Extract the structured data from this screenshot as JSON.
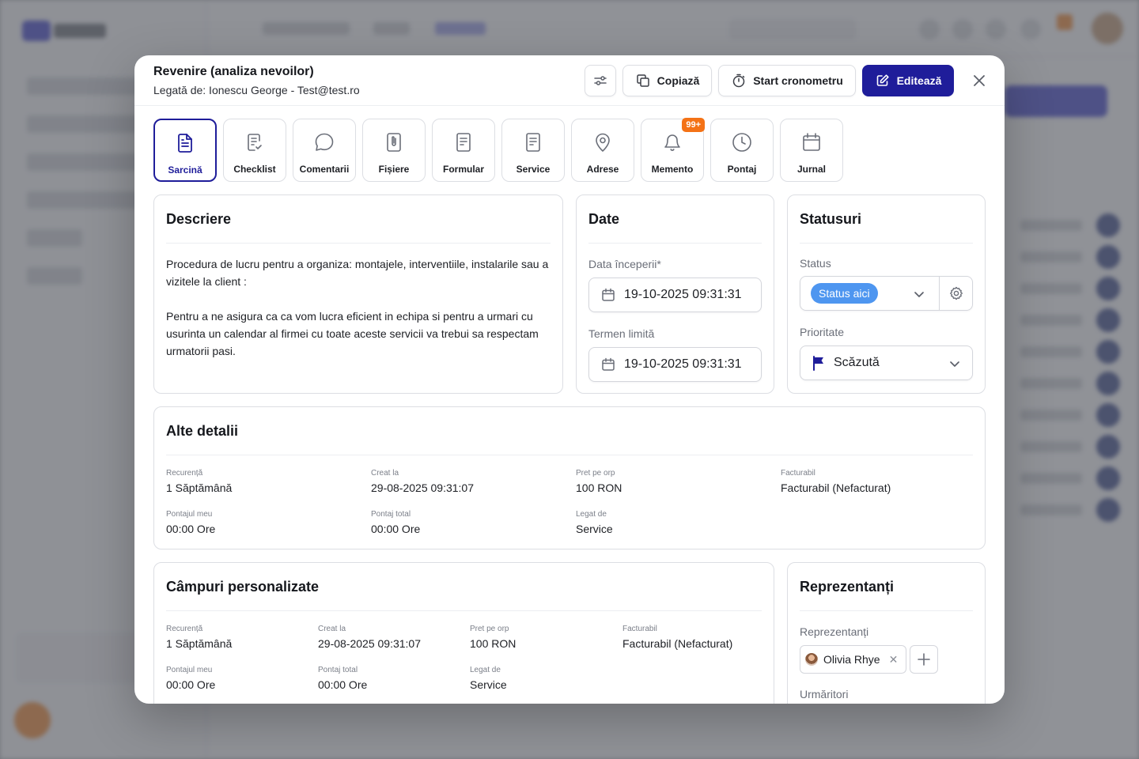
{
  "modal": {
    "title": "Revenire (analiza nevoilor)",
    "subtitle": "Legată de: Ionescu George - Test@test.ro",
    "buttons": {
      "copy": "Copiază",
      "timer": "Start cronometru",
      "edit": "Editează"
    }
  },
  "tabs": [
    {
      "label": "Sarcină",
      "icon": "task-doc-icon",
      "active": true
    },
    {
      "label": "Checklist",
      "icon": "checklist-icon"
    },
    {
      "label": "Comentarii",
      "icon": "comment-bubble-icon"
    },
    {
      "label": "Fișiere",
      "icon": "paperclip-file-icon"
    },
    {
      "label": "Formular",
      "icon": "form-doc-icon"
    },
    {
      "label": "Service",
      "icon": "service-doc-icon"
    },
    {
      "label": "Adrese",
      "icon": "map-pin-icon"
    },
    {
      "label": "Memento",
      "icon": "bell-icon",
      "badge": "99+"
    },
    {
      "label": "Pontaj",
      "icon": "clock-icon"
    },
    {
      "label": "Jurnal",
      "icon": "calendar-icon"
    }
  ],
  "description": {
    "title": "Descriere",
    "paragraph1": "Procedura de lucru pentru a organiza: montajele, interventiile, instalarile sau a vizitele la client :",
    "paragraph2": "Pentru a ne asigura ca ca vom lucra eficient in echipa si pentru a urmari cu usurinta un calendar al firmei cu toate aceste servicii va trebui sa respectam urmatorii pasi."
  },
  "dates": {
    "title": "Date",
    "start_label": "Data începerii",
    "start_required": "*",
    "start_value": "19-10-2025 09:31:31",
    "deadline_label": "Termen limită",
    "deadline_value": "19-10-2025 09:31:31"
  },
  "statuses": {
    "title": "Statusuri",
    "status_label": "Status",
    "status_value": "Status aici",
    "status_color": "#4e96f0",
    "priority_label": "Prioritate",
    "priority_value": "Scăzută",
    "priority_flag_color": "#1f1d9a"
  },
  "other_details": {
    "title": "Alte detalii",
    "fields": [
      {
        "label": "Recurență",
        "value": "1 Săptămână"
      },
      {
        "label": "Creat la",
        "value": "29-08-2025 09:31:07"
      },
      {
        "label": "Pret pe orp",
        "value": "100 RON"
      },
      {
        "label": "Facturabil",
        "value": "Facturabil (Nefacturat)"
      },
      {
        "label": "Pontajul meu",
        "value": "00:00 Ore"
      },
      {
        "label": "Pontaj total",
        "value": "00:00 Ore"
      },
      {
        "label": "Legat de",
        "value": "Service"
      }
    ]
  },
  "custom_fields": {
    "title": "Câmpuri personalizate",
    "fields": [
      {
        "label": "Recurență",
        "value": "1 Săptămână"
      },
      {
        "label": "Creat la",
        "value": "29-08-2025 09:31:07"
      },
      {
        "label": "Pret pe orp",
        "value": "100 RON"
      },
      {
        "label": "Facturabil",
        "value": "Facturabil (Nefacturat)"
      },
      {
        "label": "Pontajul meu",
        "value": "00:00 Ore"
      },
      {
        "label": "Pontaj total",
        "value": "00:00 Ore"
      },
      {
        "label": "Legat de",
        "value": "Service"
      }
    ]
  },
  "representatives": {
    "title": "Reprezentanți",
    "label": "Reprezentanți",
    "person": "Olivia Rhye",
    "followers_label": "Urmăritori"
  },
  "colors": {
    "primary": "#1f1d9a",
    "badge": "#f47216"
  }
}
